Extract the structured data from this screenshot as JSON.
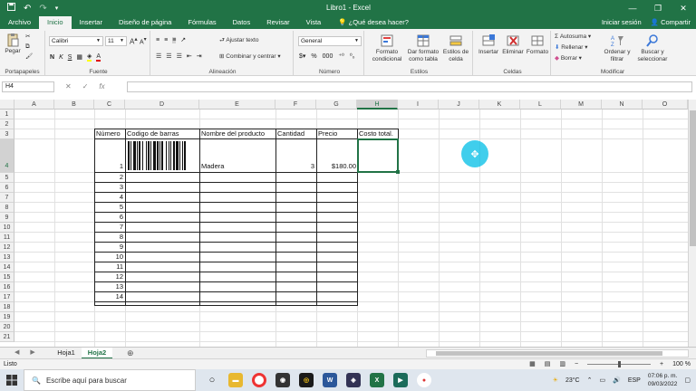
{
  "window": {
    "title": "Libro1 - Excel",
    "qat": {
      "save_icon": "save-icon",
      "undo_icon": "undo-icon",
      "redo_icon": "redo-icon",
      "customize_icon": "customize-icon"
    },
    "controls": [
      "—",
      "❐",
      "✕"
    ]
  },
  "tabs": [
    "Archivo",
    "Inicio",
    "Insertar",
    "Diseño de página",
    "Fórmulas",
    "Datos",
    "Revisar",
    "Vista"
  ],
  "tell_me": "¿Qué desea hacer?",
  "account": {
    "signin": "Iniciar sesión",
    "share": "Compartir"
  },
  "ribbon": {
    "clipboard": {
      "paste": "Pegar",
      "label": "Portapapeles"
    },
    "font": {
      "name": "Calibri",
      "size": "11",
      "bold": "N",
      "italic": "K",
      "underline": "S",
      "label": "Fuente"
    },
    "alignment": {
      "wrap": "Ajustar texto",
      "merge": "Combinar y centrar",
      "label": "Alineación"
    },
    "number": {
      "format": "General",
      "percent": "%",
      "thousands": "000",
      "label": "Número"
    },
    "styles": {
      "cond_format_1": "Formato",
      "cond_format_2": "condicional",
      "as_table_1": "Dar formato",
      "as_table_2": "como tabla",
      "cell_styles_1": "Estilos de",
      "cell_styles_2": "celda",
      "label": "Estilos"
    },
    "cells": {
      "insert": "Insertar",
      "delete": "Eliminar",
      "format": "Formato",
      "label": "Celdas"
    },
    "editing": {
      "autosum": "Autosuma",
      "fill": "Rellenar",
      "clear": "Borrar",
      "sort_1": "Ordenar y",
      "sort_2": "filtrar",
      "find_1": "Buscar y",
      "find_2": "seleccionar",
      "label": "Modificar"
    }
  },
  "formula_bar": {
    "name_box": "H4",
    "cancel": "✕",
    "enter": "✓",
    "fx": "fx",
    "value": ""
  },
  "columns": [
    "A",
    "B",
    "C",
    "D",
    "E",
    "F",
    "G",
    "H",
    "I",
    "J",
    "K",
    "L",
    "M",
    "N",
    "O"
  ],
  "rows": [
    "1",
    "2",
    "3",
    "4",
    "5",
    "6",
    "7",
    "8",
    "9",
    "10",
    "11",
    "12",
    "13",
    "14",
    "15",
    "16",
    "17",
    "18",
    "19",
    "20",
    "21"
  ],
  "selected": {
    "column": "H",
    "row": "4"
  },
  "table": {
    "headers": [
      "Número",
      "Codigo de barras",
      "Nombre del producto",
      "Cantidad",
      "Precio",
      "Costo total."
    ],
    "first_row": {
      "numero": "1",
      "producto": "Madera",
      "cantidad": "3",
      "precio": "$180.00"
    },
    "numbers": [
      "2",
      "3",
      "4",
      "5",
      "6",
      "7",
      "8",
      "9",
      "10",
      "11",
      "12",
      "13",
      "14"
    ]
  },
  "sheets": [
    "Hoja1",
    "Hoja2"
  ],
  "active_sheet": "Hoja2",
  "status": {
    "ready": "Listo",
    "zoom": "100 %"
  },
  "taskbar": {
    "search_placeholder": "Escribe aquí para buscar",
    "weather": "23°C",
    "language": "ESP",
    "time": "07:06 p. m.",
    "date": "09/03/2022"
  },
  "colors": {
    "excel_green": "#217346",
    "cursor": "#00bee6"
  }
}
